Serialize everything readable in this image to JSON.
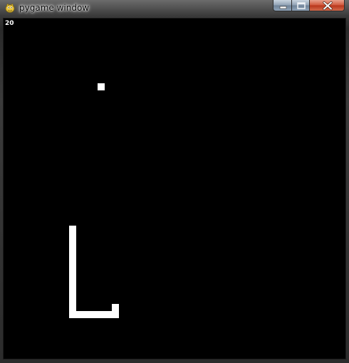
{
  "window": {
    "title": "pygame window",
    "app_icon": "pygame-snake-icon",
    "controls": {
      "minimize_icon": "minimize-icon",
      "maximize_icon": "maximize-icon",
      "close_icon": "close-icon"
    }
  },
  "game": {
    "score": "20",
    "background_color": "#000000",
    "foreground_color": "#ffffff",
    "grid_unit": 10,
    "food": [
      13,
      9
    ],
    "snake_segments": [
      [
        9,
        29
      ],
      [
        9,
        30
      ],
      [
        9,
        31
      ],
      [
        9,
        32
      ],
      [
        9,
        33
      ],
      [
        9,
        34
      ],
      [
        9,
        35
      ],
      [
        9,
        36
      ],
      [
        9,
        37
      ],
      [
        9,
        38
      ],
      [
        9,
        39
      ],
      [
        9,
        40
      ],
      [
        9,
        41
      ],
      [
        10,
        41
      ],
      [
        11,
        41
      ],
      [
        12,
        41
      ],
      [
        13,
        41
      ],
      [
        14,
        41
      ],
      [
        15,
        41
      ],
      [
        15,
        40
      ]
    ]
  }
}
